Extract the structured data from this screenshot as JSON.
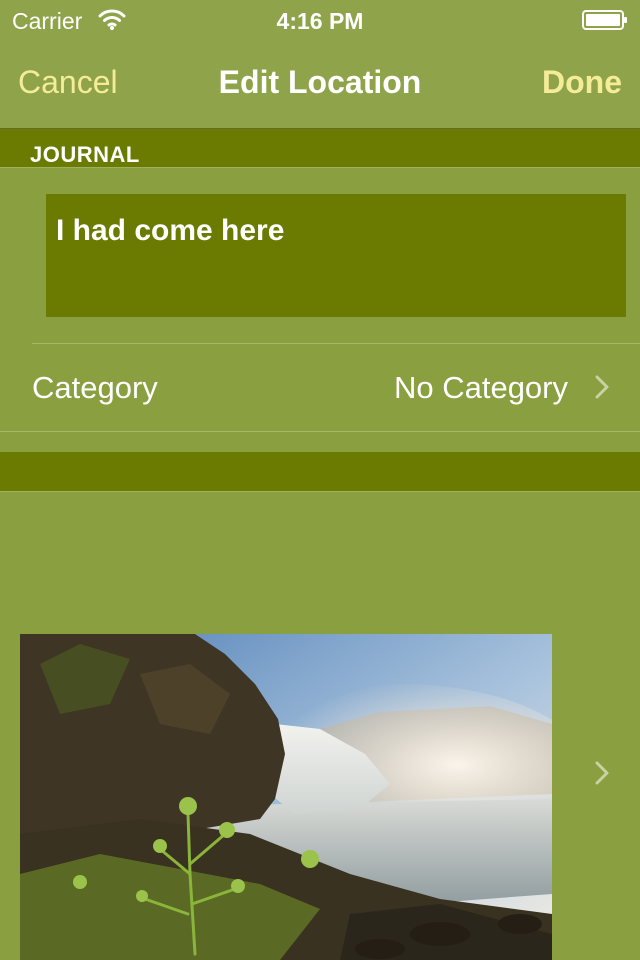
{
  "status_bar": {
    "carrier": "Carrier",
    "time": "4:16 PM",
    "icons": [
      "wifi-icon",
      "battery-icon"
    ]
  },
  "nav": {
    "cancel_label": "Cancel",
    "title": "Edit Location",
    "done_label": "Done"
  },
  "journal": {
    "header": "JOURNAL",
    "text": "I had come here"
  },
  "category": {
    "label": "Category",
    "value": "No Category",
    "icon": "chevron-right-icon"
  },
  "photo": {
    "icon": "chevron-right-icon"
  },
  "colors": {
    "background": "#8aa040",
    "bar": "#8fa34a",
    "dark_olive": "#6b7a00",
    "accent": "#f5ec98",
    "text": "#ffffff"
  }
}
